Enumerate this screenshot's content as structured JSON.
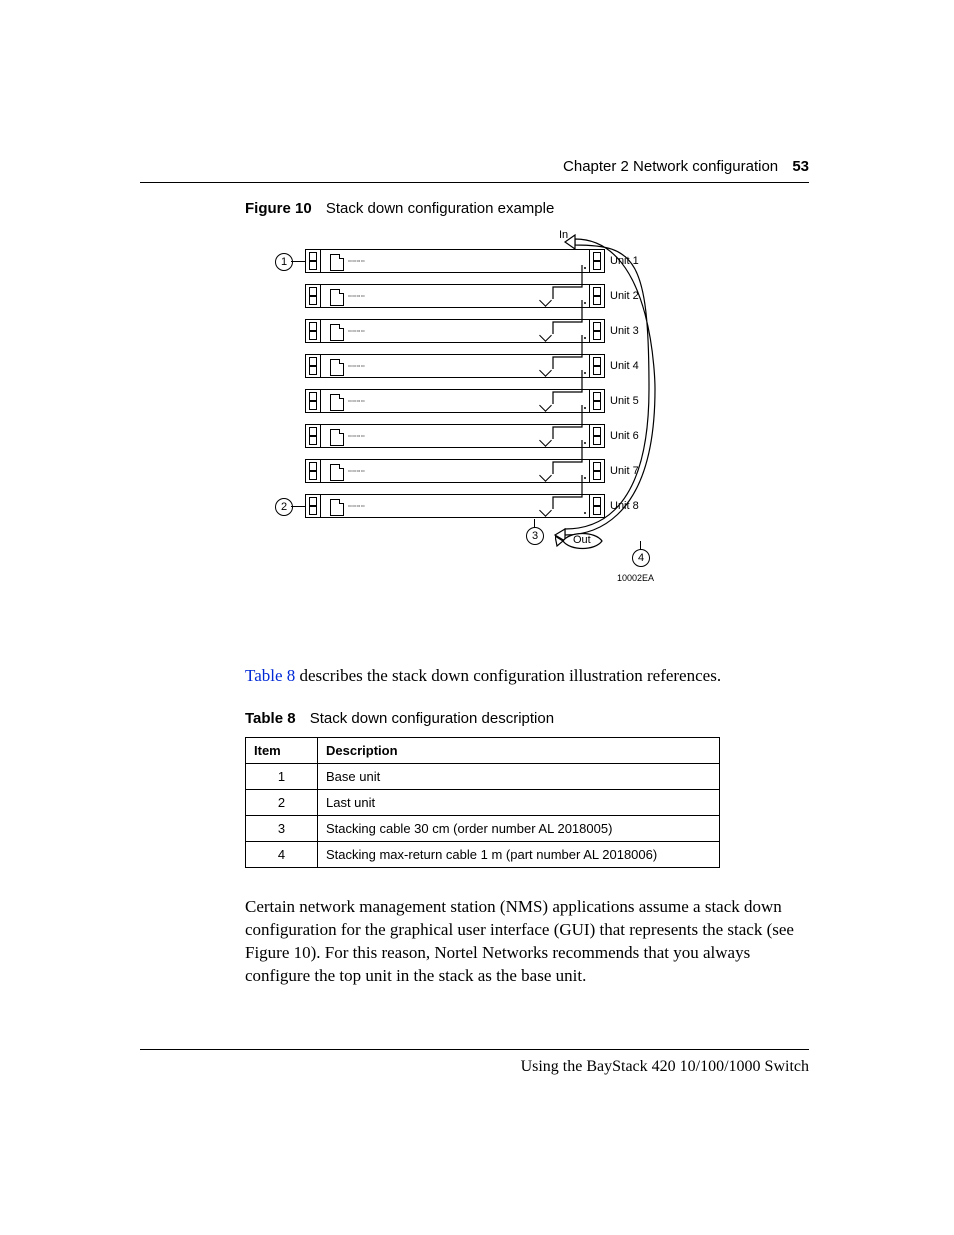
{
  "header": {
    "chapter": "Chapter 2  Network configuration",
    "page_number": "53"
  },
  "footer": {
    "text": "Using the BayStack 420 10/100/1000 Switch"
  },
  "figure": {
    "label": "Figure 10",
    "title": "Stack down configuration example",
    "in_label": "In",
    "out_label": "Out",
    "id_code": "10002EA",
    "units": [
      "Unit 1",
      "Unit 2",
      "Unit 3",
      "Unit 4",
      "Unit 5",
      "Unit 6",
      "Unit 7",
      "Unit 8"
    ],
    "callouts": {
      "c1": "1",
      "c2": "2",
      "c3": "3",
      "c4": "4"
    }
  },
  "para1": {
    "link": "Table 8",
    "rest": " describes the stack down configuration illustration references."
  },
  "table": {
    "label": "Table 8",
    "title": "Stack down configuration description",
    "headers": {
      "item": "Item",
      "desc": "Description"
    },
    "rows": [
      {
        "item": "1",
        "desc": "Base unit"
      },
      {
        "item": "2",
        "desc": "Last unit"
      },
      {
        "item": "3",
        "desc": "Stacking cable 30 cm (order number AL 2018005)"
      },
      {
        "item": "4",
        "desc": "Stacking max-return cable 1 m (part number AL 2018006)"
      }
    ]
  },
  "para2": {
    "t1": "Certain network management station (NMS) applications assume a stack down configuration for the graphical user interface (GUI) that represents the stack (see ",
    "link": "Figure 10",
    "t2": "). For this reason, Nortel Networks recommends that you always configure the top unit in the stack as the base unit."
  }
}
